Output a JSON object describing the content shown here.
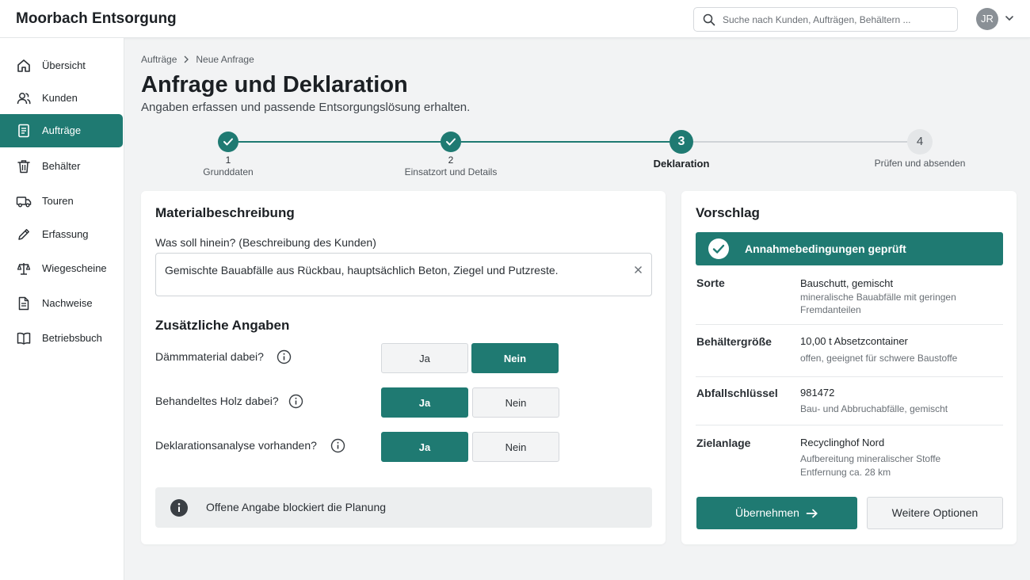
{
  "app": {
    "title": "Moorbach Entsorgung"
  },
  "search": {
    "placeholder": "Suche nach Kunden, Aufträgen, Behältern ..."
  },
  "user": {
    "initials": "JR"
  },
  "sidebar": {
    "items": [
      {
        "label": "Übersicht",
        "icon": "home-icon"
      },
      {
        "label": "Kunden",
        "icon": "users-icon"
      },
      {
        "label": "Aufträge",
        "icon": "document-icon",
        "active": true
      },
      {
        "label": "Behälter",
        "icon": "trash-icon"
      },
      {
        "label": "Touren",
        "icon": "truck-icon"
      },
      {
        "label": "Erfassung",
        "icon": "pencil-icon"
      },
      {
        "label": "Wiegescheine",
        "icon": "scale-icon"
      },
      {
        "label": "Nachweise",
        "icon": "file-icon"
      },
      {
        "label": "Betriebsbuch",
        "icon": "book-icon"
      }
    ]
  },
  "breadcrumb": {
    "parent": "Aufträge",
    "current": "Neue Anfrage"
  },
  "page": {
    "title": "Anfrage und Deklaration",
    "subtitle": "Angaben erfassen und passende Entsorgungslösung erhalten."
  },
  "stepper": {
    "steps": [
      {
        "number": "1",
        "label": "Grunddaten",
        "state": "done"
      },
      {
        "number": "2",
        "label": "Einsatzort und Details",
        "state": "done"
      },
      {
        "number": "3",
        "label": "Deklaration",
        "state": "active"
      },
      {
        "number": "4",
        "label": "Prüfen und absenden",
        "state": "todo"
      }
    ]
  },
  "material": {
    "heading": "Materialbeschreibung",
    "question_label": "Was soll hinein? (Beschreibung des Kunden)",
    "description": "Gemischte Bauabfälle aus Rückbau, hauptsächlich Beton, Ziegel und Putzreste."
  },
  "additional": {
    "heading": "Zusätzliche Angaben",
    "yes_label": "Ja",
    "no_label": "Nein",
    "questions": [
      {
        "label": "Dämmmaterial dabei?",
        "selected": "Nein"
      },
      {
        "label": "Behandeltes Holz dabei?",
        "selected": "Ja"
      },
      {
        "label": "Deklarationsanalyse vorhanden?",
        "selected": "Ja"
      }
    ]
  },
  "alert": {
    "text": "Offene Angabe blockiert die Planung"
  },
  "proposal": {
    "heading": "Vorschlag",
    "status": "Annahmebedingungen geprüft",
    "rows": [
      {
        "key": "Sorte",
        "value": "Bauschutt, gemischt",
        "sub": "mineralische Bauabfälle mit geringen Fremdanteilen"
      },
      {
        "key": "Behältergröße",
        "value": "10,00 t Absetzcontainer",
        "sub": "offen, geeignet für schwere Baustoffe"
      },
      {
        "key": "Abfallschlüssel",
        "value": "981472",
        "sub": "Bau- und Abbruchabfälle, gemischt"
      },
      {
        "key": "Zielanlage",
        "value": "Recyclinghof Nord",
        "sub": "Aufbereitung mineralischer Stoffe\nEntfernung ca. 28 km"
      }
    ],
    "accept_label": "Übernehmen",
    "more_label": "Weitere Optionen"
  },
  "colors": {
    "accent": "#1f7a72",
    "background": "#f2f3f4"
  }
}
